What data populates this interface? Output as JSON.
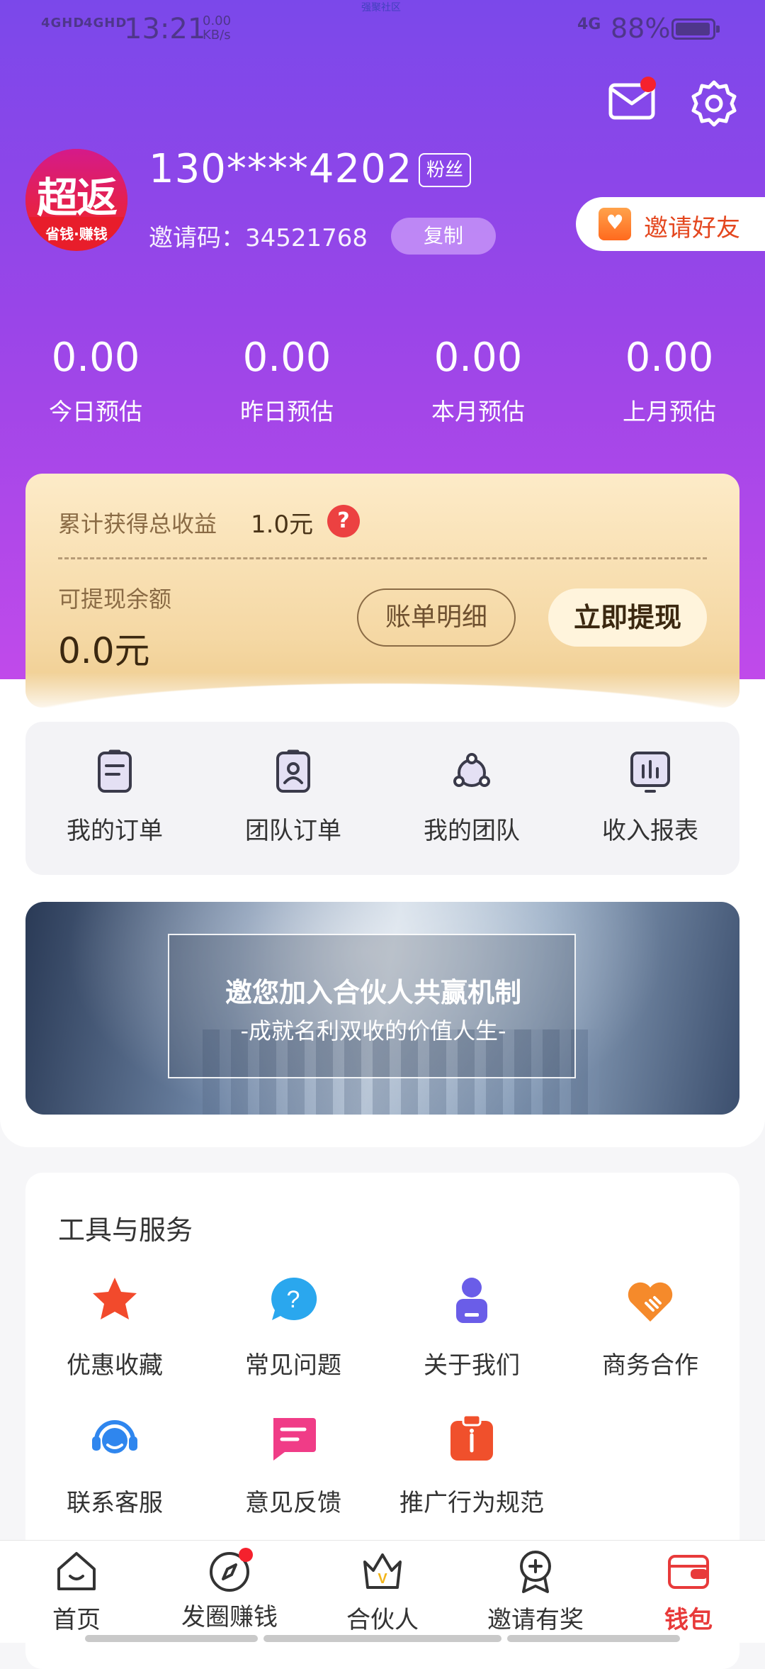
{
  "status_bar": {
    "signal_1": "4GHD",
    "signal_2": "4GHD",
    "time": "13:21",
    "speed_value": "0.00",
    "speed_unit": "KB/s",
    "network": "4G",
    "battery": "88%",
    "notch_text": "强聚社区"
  },
  "profile": {
    "avatar_logo": "超返",
    "avatar_sub": "省钱·赚钱",
    "phone": "130****4202",
    "badge": "粉丝",
    "invite_code_label": "邀请码：",
    "invite_code": "34521768",
    "copy_label": "复制",
    "invite_friends_label": "邀请好友"
  },
  "stats": [
    {
      "value": "0.00",
      "label": "今日预估"
    },
    {
      "value": "0.00",
      "label": "昨日预估"
    },
    {
      "value": "0.00",
      "label": "本月预估"
    },
    {
      "value": "0.00",
      "label": "上月预估"
    }
  ],
  "earnings": {
    "total_label": "累计获得总收益",
    "total_value": "1.0元",
    "help_glyph": "?",
    "balance_label": "可提现余额",
    "balance_value": "0.0元",
    "bill_label": "账单明细",
    "withdraw_label": "立即提现"
  },
  "orders_menu": [
    {
      "label": "我的订单",
      "icon": "order-list-icon"
    },
    {
      "label": "团队订单",
      "icon": "team-order-icon"
    },
    {
      "label": "我的团队",
      "icon": "team-icon"
    },
    {
      "label": "收入报表",
      "icon": "report-icon"
    }
  ],
  "banner": {
    "title": "邀您加入合伙人共赢机制",
    "subtitle": "-成就名利双收的价值人生-"
  },
  "tools": {
    "title": "工具与服务",
    "items": [
      {
        "label": "优惠收藏",
        "icon": "star-icon",
        "color": "#f24a2c"
      },
      {
        "label": "常见问题",
        "icon": "question-icon",
        "color": "#2aa7ee"
      },
      {
        "label": "关于我们",
        "icon": "person-icon",
        "color": "#6a5de8"
      },
      {
        "label": "商务合作",
        "icon": "handshake-heart-icon",
        "color": "#f58a2b"
      },
      {
        "label": "联系客服",
        "icon": "headset-icon",
        "color": "#2f86ee"
      },
      {
        "label": "意见反馈",
        "icon": "feedback-icon",
        "color": "#f03c87"
      },
      {
        "label": "推广行为规范",
        "icon": "clipboard-icon",
        "color": "#f0502c"
      }
    ]
  },
  "tabbar": [
    {
      "label": "首页",
      "icon": "home-icon"
    },
    {
      "label": "发圈赚钱",
      "icon": "compass-icon"
    },
    {
      "label": "合伙人",
      "icon": "crown-icon"
    },
    {
      "label": "邀请有奖",
      "icon": "award-icon"
    },
    {
      "label": "钱包",
      "icon": "wallet-icon",
      "active": true
    }
  ],
  "colors": {
    "hero_top": "#7b48ea",
    "hero_bottom": "#c44bea",
    "accent_red": "#e83a3a",
    "card_gold": "#f5d8a4"
  }
}
